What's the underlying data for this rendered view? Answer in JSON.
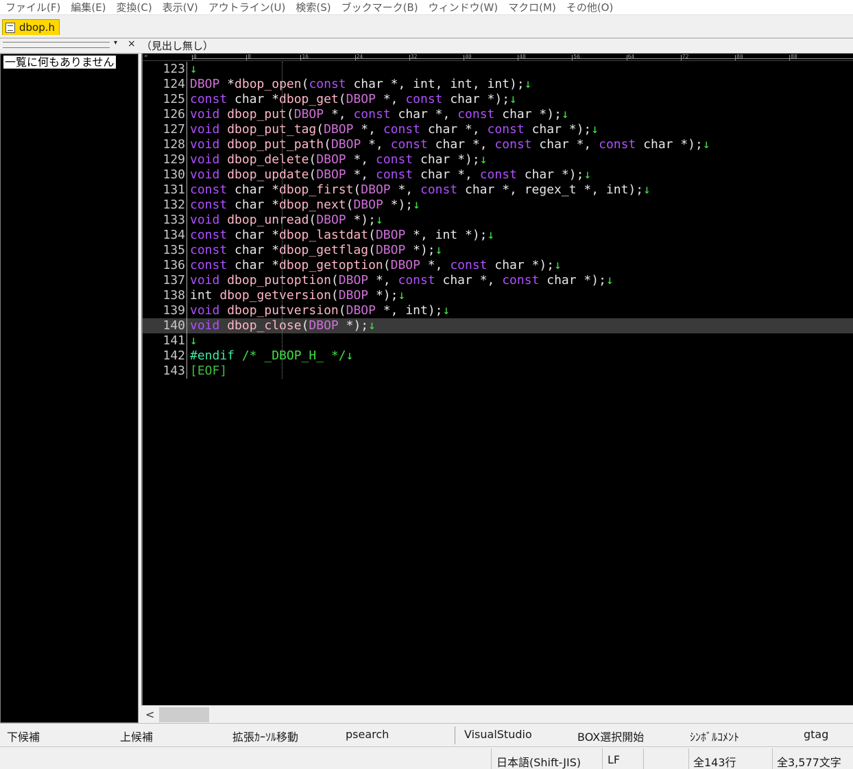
{
  "menu": [
    "ファイル(F)",
    "編集(E)",
    "変換(C)",
    "表示(V)",
    "アウトライン(U)",
    "検索(S)",
    "ブックマーク(B)",
    "ウィンドウ(W)",
    "マクロ(M)",
    "その他(O)"
  ],
  "tab": {
    "label": "dbop.h"
  },
  "outline": {
    "dropdown_glyph": "▾",
    "close_glyph": "×",
    "heading": "（見出し無し）",
    "empty_message": "一覧に何もありません"
  },
  "ruler": {
    "corner": "»",
    "labels": [
      "0",
      "8",
      "16",
      "24",
      "32",
      "40",
      "48",
      "56",
      "64",
      "72",
      "80",
      "88"
    ]
  },
  "code": {
    "newline_mark": "↓",
    "current_line": 140,
    "lines": [
      {
        "n": "123",
        "tokens": []
      },
      {
        "n": "124",
        "tokens": [
          [
            "ty",
            "DBOP"
          ],
          [
            "id",
            " *"
          ],
          [
            "fn",
            "dbop_open"
          ],
          [
            "id",
            "("
          ],
          [
            "kw",
            "const"
          ],
          [
            "id",
            " char *, int, int, int);"
          ]
        ]
      },
      {
        "n": "125",
        "tokens": [
          [
            "kw",
            "const"
          ],
          [
            "id",
            " char *"
          ],
          [
            "fn",
            "dbop_get"
          ],
          [
            "id",
            "("
          ],
          [
            "ty",
            "DBOP"
          ],
          [
            "id",
            " *, "
          ],
          [
            "kw",
            "const"
          ],
          [
            "id",
            " char *);"
          ]
        ]
      },
      {
        "n": "126",
        "tokens": [
          [
            "kw",
            "void"
          ],
          [
            "id",
            " "
          ],
          [
            "fn",
            "dbop_put"
          ],
          [
            "id",
            "("
          ],
          [
            "ty",
            "DBOP"
          ],
          [
            "id",
            " *, "
          ],
          [
            "kw",
            "const"
          ],
          [
            "id",
            " char *, "
          ],
          [
            "kw",
            "const"
          ],
          [
            "id",
            " char *);"
          ]
        ]
      },
      {
        "n": "127",
        "tokens": [
          [
            "kw",
            "void"
          ],
          [
            "id",
            " "
          ],
          [
            "fn",
            "dbop_put_tag"
          ],
          [
            "id",
            "("
          ],
          [
            "ty",
            "DBOP"
          ],
          [
            "id",
            " *, "
          ],
          [
            "kw",
            "const"
          ],
          [
            "id",
            " char *, "
          ],
          [
            "kw",
            "const"
          ],
          [
            "id",
            " char *);"
          ]
        ]
      },
      {
        "n": "128",
        "tokens": [
          [
            "kw",
            "void"
          ],
          [
            "id",
            " "
          ],
          [
            "fn",
            "dbop_put_path"
          ],
          [
            "id",
            "("
          ],
          [
            "ty",
            "DBOP"
          ],
          [
            "id",
            " *, "
          ],
          [
            "kw",
            "const"
          ],
          [
            "id",
            " char *, "
          ],
          [
            "kw",
            "const"
          ],
          [
            "id",
            " char *, "
          ],
          [
            "kw",
            "const"
          ],
          [
            "id",
            " char *);"
          ]
        ]
      },
      {
        "n": "129",
        "tokens": [
          [
            "kw",
            "void"
          ],
          [
            "id",
            " "
          ],
          [
            "fn",
            "dbop_delete"
          ],
          [
            "id",
            "("
          ],
          [
            "ty",
            "DBOP"
          ],
          [
            "id",
            " *, "
          ],
          [
            "kw",
            "const"
          ],
          [
            "id",
            " char *);"
          ]
        ]
      },
      {
        "n": "130",
        "tokens": [
          [
            "kw",
            "void"
          ],
          [
            "id",
            " "
          ],
          [
            "fn",
            "dbop_update"
          ],
          [
            "id",
            "("
          ],
          [
            "ty",
            "DBOP"
          ],
          [
            "id",
            " *, "
          ],
          [
            "kw",
            "const"
          ],
          [
            "id",
            " char *, "
          ],
          [
            "kw",
            "const"
          ],
          [
            "id",
            " char *);"
          ]
        ]
      },
      {
        "n": "131",
        "tokens": [
          [
            "kw",
            "const"
          ],
          [
            "id",
            " char *"
          ],
          [
            "fn",
            "dbop_first"
          ],
          [
            "id",
            "("
          ],
          [
            "ty",
            "DBOP"
          ],
          [
            "id",
            " *, "
          ],
          [
            "kw",
            "const"
          ],
          [
            "id",
            " char *, regex_t *, int);"
          ]
        ]
      },
      {
        "n": "132",
        "tokens": [
          [
            "kw",
            "const"
          ],
          [
            "id",
            " char *"
          ],
          [
            "fn",
            "dbop_next"
          ],
          [
            "id",
            "("
          ],
          [
            "ty",
            "DBOP"
          ],
          [
            "id",
            " *);"
          ]
        ]
      },
      {
        "n": "133",
        "tokens": [
          [
            "kw",
            "void"
          ],
          [
            "id",
            " "
          ],
          [
            "fn",
            "dbop_unread"
          ],
          [
            "id",
            "("
          ],
          [
            "ty",
            "DBOP"
          ],
          [
            "id",
            " *);"
          ]
        ]
      },
      {
        "n": "134",
        "tokens": [
          [
            "kw",
            "const"
          ],
          [
            "id",
            " char *"
          ],
          [
            "fn",
            "dbop_lastdat"
          ],
          [
            "id",
            "("
          ],
          [
            "ty",
            "DBOP"
          ],
          [
            "id",
            " *, int *);"
          ]
        ]
      },
      {
        "n": "135",
        "tokens": [
          [
            "kw",
            "const"
          ],
          [
            "id",
            " char *"
          ],
          [
            "fn",
            "dbop_getflag"
          ],
          [
            "id",
            "("
          ],
          [
            "ty",
            "DBOP"
          ],
          [
            "id",
            " *);"
          ]
        ]
      },
      {
        "n": "136",
        "tokens": [
          [
            "kw",
            "const"
          ],
          [
            "id",
            " char *"
          ],
          [
            "fn",
            "dbop_getoption"
          ],
          [
            "id",
            "("
          ],
          [
            "ty",
            "DBOP"
          ],
          [
            "id",
            " *, "
          ],
          [
            "kw",
            "const"
          ],
          [
            "id",
            " char *);"
          ]
        ]
      },
      {
        "n": "137",
        "tokens": [
          [
            "kw",
            "void"
          ],
          [
            "id",
            " "
          ],
          [
            "fn",
            "dbop_putoption"
          ],
          [
            "id",
            "("
          ],
          [
            "ty",
            "DBOP"
          ],
          [
            "id",
            " *, "
          ],
          [
            "kw",
            "const"
          ],
          [
            "id",
            " char *, "
          ],
          [
            "kw",
            "const"
          ],
          [
            "id",
            " char *);"
          ]
        ]
      },
      {
        "n": "138",
        "tokens": [
          [
            "id",
            "int "
          ],
          [
            "fn",
            "dbop_getversion"
          ],
          [
            "id",
            "("
          ],
          [
            "ty",
            "DBOP"
          ],
          [
            "id",
            " *);"
          ]
        ]
      },
      {
        "n": "139",
        "tokens": [
          [
            "kw",
            "void"
          ],
          [
            "id",
            " "
          ],
          [
            "fn",
            "dbop_putversion"
          ],
          [
            "id",
            "("
          ],
          [
            "ty",
            "DBOP"
          ],
          [
            "id",
            " *, int);"
          ]
        ]
      },
      {
        "n": "140",
        "tokens": [
          [
            "kw",
            "void"
          ],
          [
            "id",
            " "
          ],
          [
            "fn",
            "dbop_close"
          ],
          [
            "id",
            "("
          ],
          [
            "ty",
            "DBOP"
          ],
          [
            "id",
            " *);"
          ]
        ]
      },
      {
        "n": "141",
        "tokens": []
      },
      {
        "n": "142",
        "tokens": [
          [
            "pp",
            "#endif"
          ],
          [
            "id",
            " "
          ],
          [
            "cm",
            "/* _DBOP_H_ */"
          ]
        ]
      },
      {
        "n": "143",
        "tokens": [
          [
            "eof",
            "[EOF]"
          ]
        ],
        "no_newline": true
      }
    ]
  },
  "scrollbar": {
    "left_arrow": "<"
  },
  "function_keys": [
    "下候補",
    "上候補",
    "拡張ｶｰｿﾙ移動",
    "psearch",
    "VisualStudio",
    "BOX選択開始",
    "ｼﾝﾎﾞﾙｺﾒﾝﾄ",
    "gtag"
  ],
  "status": {
    "encoding": "日本語(Shift-JIS)",
    "line_ending": "LF",
    "total_lines": "全143行",
    "total_chars": "全3,577文字"
  }
}
